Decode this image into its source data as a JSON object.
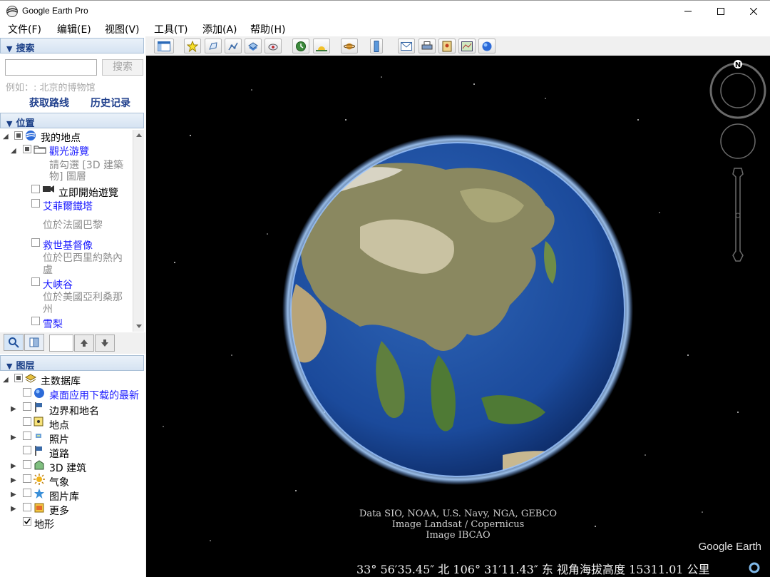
{
  "window": {
    "title": "Google Earth Pro",
    "minimize": "—",
    "maximize": "☐",
    "close": "✕"
  },
  "menu": [
    "文件(F)",
    "编辑(E)",
    "视图(V)",
    "工具(T)",
    "添加(A)",
    "帮助(H)"
  ],
  "search": {
    "header": "搜索",
    "button": "搜索",
    "hint": "例如：: 北京的博物馆",
    "get_directions": "获取路线",
    "history": "历史记录",
    "value": ""
  },
  "places": {
    "header": "位置",
    "items": [
      {
        "label": "我的地点"
      },
      {
        "label": "觀光游覽"
      },
      {
        "label": "請勾選 [3D 建築"
      },
      {
        "label": "物] 圖層"
      },
      {
        "label": "立即開始遊覽"
      },
      {
        "label": "艾菲爾鐵塔"
      },
      {
        "label": "位於法國巴黎"
      },
      {
        "label": "救世基督像"
      },
      {
        "label": "位於巴西里約熱內"
      },
      {
        "label": "盧"
      },
      {
        "label": "大峽谷"
      },
      {
        "label": "位於美國亞利桑那"
      },
      {
        "label": "州"
      },
      {
        "label": "雪梨"
      }
    ]
  },
  "layers": {
    "header": "图层",
    "items": [
      {
        "label": "主数据库"
      },
      {
        "label": "桌面应用下载的最新"
      },
      {
        "label": "边界和地名"
      },
      {
        "label": "地点"
      },
      {
        "label": "照片"
      },
      {
        "label": "道路"
      },
      {
        "label": "3D 建筑"
      },
      {
        "label": "气象"
      },
      {
        "label": "图片库"
      },
      {
        "label": "更多"
      },
      {
        "label": "地形"
      }
    ]
  },
  "navigation": {
    "north": "N"
  },
  "attribution": [
    "Data SIO, NOAA, U.S. Navy, NGA, GEBCO",
    "Image Landsat / Copernicus",
    "Image IBCAO"
  ],
  "brand": "Google Earth",
  "status": {
    "lat": "33° 56′35.45″ 北",
    "lon": "106° 31′11.43″ 东",
    "alt_label": "视角海拔高度",
    "alt_value": "15311.01 公里"
  },
  "colors": {
    "accent": "#1a3f87",
    "link": "#1a1aff",
    "sky": "#000000",
    "ocean": "#1c4fa0"
  }
}
